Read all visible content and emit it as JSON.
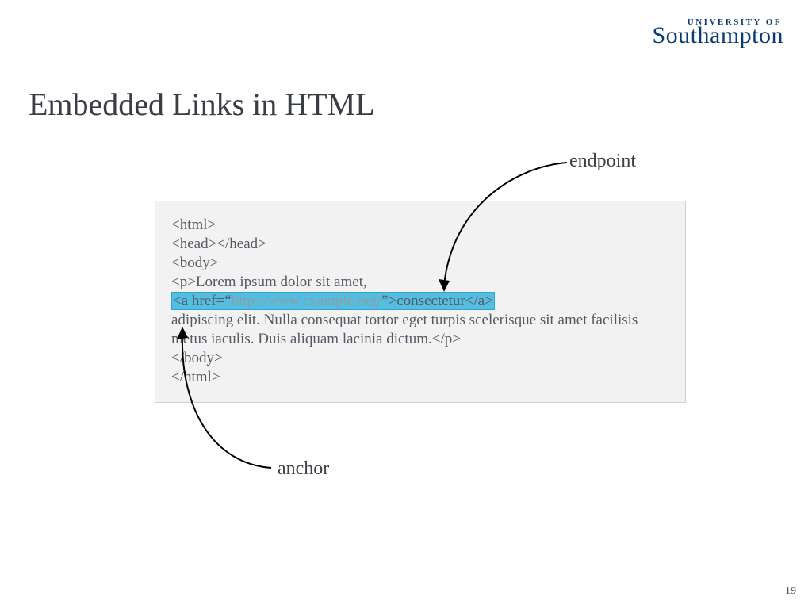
{
  "logo": {
    "top": "UNIVERSITY OF",
    "main": "Southampton"
  },
  "title": "Embedded Links in HTML",
  "labels": {
    "endpoint": "endpoint",
    "anchor": "anchor"
  },
  "code": {
    "l1": "<html>",
    "l2": "<head></head>",
    "l3": "<body>",
    "l4": "<p>Lorem ipsum dolor sit amet,",
    "l5a": "<a href=“",
    "l5url": "http://www.example.org/",
    "l5b": "”>consectetur</a>",
    "l6": "adipiscing elit. Nulla consequat tortor eget turpis scelerisque sit amet facilisis metus iaculis. Duis aliquam lacinia dictum.</p>",
    "l7": "</body>",
    "l8": "</html>"
  },
  "pagenum": "19"
}
